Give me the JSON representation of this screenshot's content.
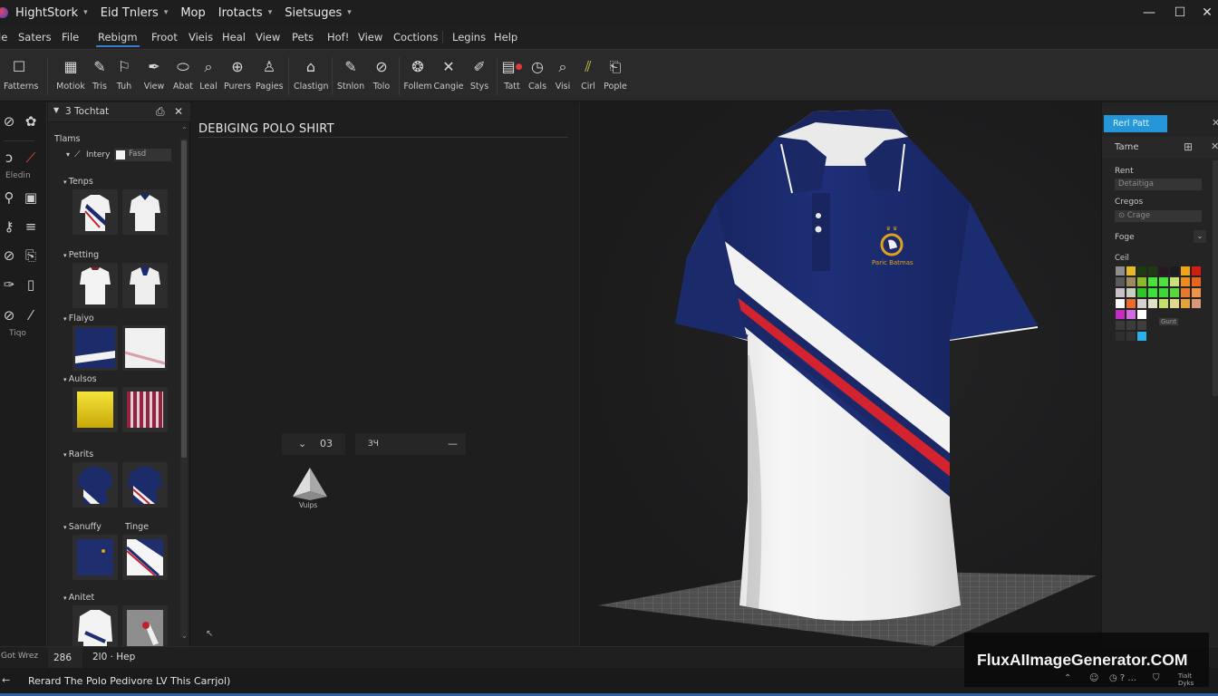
{
  "app": {
    "title_menus": [
      {
        "label": "HightStork",
        "has_dropdown": true
      },
      {
        "label": "Eid Tnlers",
        "has_dropdown": true
      },
      {
        "label": "Mop",
        "has_dropdown": false
      },
      {
        "label": "Irotacts",
        "has_dropdown": true
      },
      {
        "label": "Sietsuges",
        "has_dropdown": true
      }
    ],
    "window_controls": {
      "minimize": "—",
      "maximize": "☐",
      "close": "✕"
    }
  },
  "menubar": {
    "items": [
      "le",
      "Saters",
      "File",
      "Rebigm",
      "Froot",
      "Vieis",
      "Heal",
      "View",
      "Pets",
      "Hof!",
      "View",
      "Coctions",
      "Legins",
      "Help"
    ],
    "active_index": 3
  },
  "toolbar": {
    "tools": [
      {
        "label": "Fatterns",
        "icon": "square-icon"
      },
      {
        "label": "Motiok",
        "icon": "grid-icon"
      },
      {
        "label": "Tris",
        "icon": "pencil-icon"
      },
      {
        "label": "Tuh",
        "icon": "flag-icon"
      },
      {
        "label": "View",
        "icon": "pen-icon"
      },
      {
        "label": "Abat",
        "icon": "ellipse-icon"
      },
      {
        "label": "Leal",
        "icon": "search-icon"
      },
      {
        "label": "Purers",
        "icon": "crosshair-icon"
      },
      {
        "label": "Pagies",
        "icon": "stamp-icon"
      },
      {
        "label": "Clastign",
        "icon": "home-icon"
      },
      {
        "label": "Stnlon",
        "icon": "pencil-icon"
      },
      {
        "label": "Tolo",
        "icon": "clip-icon"
      },
      {
        "label": "Follem",
        "icon": "globe-icon"
      },
      {
        "label": "Cangie",
        "icon": "close-icon"
      },
      {
        "label": "Stys",
        "icon": "brush-icon"
      },
      {
        "label": "Tatt",
        "icon": "clipboard-alert-icon"
      },
      {
        "label": "Cals",
        "icon": "clock-icon"
      },
      {
        "label": "Visi",
        "icon": "search-icon"
      },
      {
        "label": "Cirl",
        "icon": "slash-icon"
      },
      {
        "label": "Pople",
        "icon": "page-icon"
      }
    ]
  },
  "left_strip": {
    "labels": [
      "Eledin",
      "Tiqo"
    ]
  },
  "left_panel": {
    "title": "3 Tochtat",
    "items_label": "Tlams",
    "layer": {
      "label": "Intery",
      "value": "Fasd"
    },
    "sections": [
      {
        "title": "Tenps"
      },
      {
        "title": "Petting"
      },
      {
        "title": "Flaiyo"
      },
      {
        "title": "Aulsos"
      },
      {
        "title": "Rarits"
      },
      {
        "title": "Sanuffy",
        "extra": "Tinge"
      },
      {
        "title": "Anitet"
      }
    ]
  },
  "canvas": {
    "title": "DEBIGING POLO SHIRT",
    "control_a": {
      "chevron": "⌄",
      "value": "03"
    },
    "control_b": {
      "value": "ЗЧ",
      "minus": "—"
    },
    "shape_label": "Vuips"
  },
  "viewport": {
    "logo_text": "Paric Batmas",
    "colors": {
      "navy": "#1a2a6c",
      "red": "#d2232f",
      "white": "#f4f4f4",
      "logo_gold": "#e1a21a"
    }
  },
  "right_panel": {
    "tab_label": "Rerl Patt",
    "header_label": "Tame",
    "field1_label": "Rent",
    "field1_value": "Detaitiga",
    "field2_label": "Cregos",
    "field2_value": "⊙ Crage",
    "field3_label": "Foge",
    "palette_label": "Ceil",
    "palette_rows": [
      [
        "#8e8e8e",
        "#e4b826",
        "#1e3a10",
        "#1f3a13",
        "#2a1820",
        "#1b1b22",
        "#f0a418",
        "#d21c14"
      ],
      [
        "#5a5a5a",
        "#9e8a60",
        "#8fb82a",
        "#48e23a",
        "#4ee23f",
        "#c8e07a",
        "#f08a1c",
        "#e8661c"
      ],
      [
        "#c6c0c8",
        "#c7d0c0",
        "#2ec42a",
        "#3ce23a",
        "#3cd838",
        "#58d83a",
        "#e8782c",
        "#ee9448"
      ],
      [
        "#f8f8f8",
        "#ec6a2c",
        "#d8d0d0",
        "#e4dfc8",
        "#c4e06a",
        "#e0d88a",
        "#e8a23c",
        "#d89878"
      ],
      [
        "#c62cc4",
        "#d46ae0",
        "#ffffff",
        null,
        null,
        null,
        null,
        null
      ],
      [
        "#3a3a3a",
        "#3c3c3c",
        "#3e3e3e",
        null,
        null,
        null,
        null,
        null
      ],
      [
        "#2f2f2f",
        "#333333",
        "#2ab0ee",
        null,
        null,
        null,
        null,
        null
      ]
    ],
    "palette_extra": "Gunt"
  },
  "status": {
    "label": "Got Wrez",
    "value": "286",
    "extra": "2l0 · Hep"
  },
  "footer": {
    "message": "Rerard The Polo Pedivore LV This Carrjol)",
    "back_icon": "←"
  },
  "watermark": {
    "text": "FluxAIImageGenerator.COM",
    "tray_text": "Tialt Dyks"
  }
}
